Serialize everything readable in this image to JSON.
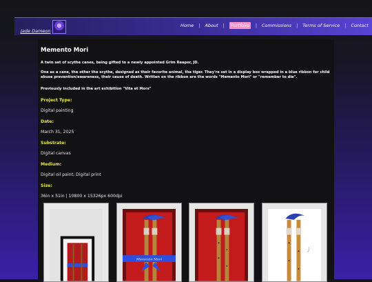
{
  "header": {
    "site_title": "Jade Dameon",
    "nav": [
      {
        "label": "Home"
      },
      {
        "label": "About"
      },
      {
        "label": "Portfolio",
        "active": true
      },
      {
        "label": "Commissions"
      },
      {
        "label": "Terms of Service"
      },
      {
        "label": "Contact"
      }
    ],
    "active_color": "#ff8fc6"
  },
  "project": {
    "title": "Memento Mori",
    "para1": "A twin set of scythe canes, being gifted to a newly appointed Grim Reaper, JD.",
    "para2": "One as a cane, the other the scythe, designed as their favorite animal, the tiger. They're set in a display box wrapped in a blue ribbon for child abuse prevention/awareness, their cause of death. Written on the ribbon are the words \"Memento Mori\" or \"remember to die\".",
    "para3": "Previously included in the art exhibition \"Vita et Mors\"",
    "fields": [
      {
        "label": "Project Type:",
        "value": "Digital painting"
      },
      {
        "label": "Date:",
        "value": "March 31, 2025"
      },
      {
        "label": "Substrate:",
        "value": "Digital canvas"
      },
      {
        "label": "Medium:",
        "value": "Digital oil paint; Digital print"
      },
      {
        "label": "Size:",
        "value": "36in x 51in | 10800 x 15326px 600dpi"
      }
    ],
    "label_color": "#e9e84a",
    "ribbon_text": "Memento    Mori"
  },
  "gallery": [
    {
      "name": "framed-print"
    },
    {
      "name": "display-box-ribbon"
    },
    {
      "name": "display-box-open"
    },
    {
      "name": "cane-pair-white"
    }
  ]
}
